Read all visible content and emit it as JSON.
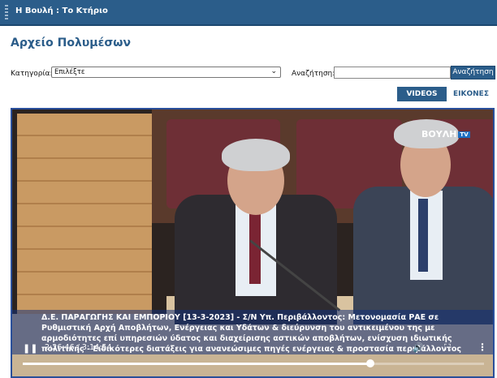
{
  "header": {
    "breadcrumb": "Η Βουλή : Το Κτήριο"
  },
  "page": {
    "title": "Αρχείο Πολυμέσων"
  },
  "filters": {
    "category_label": "Κατηγορία:",
    "category_value": "Επιλέξτε",
    "search_label": "Αναζήτηση:",
    "search_value": "",
    "search_button": "Αναζήτηση"
  },
  "tabs": [
    {
      "label": "VIDEOS",
      "active": true
    },
    {
      "label": "ΕΙΚΟΝΕΣ",
      "active": false
    }
  ],
  "player": {
    "logo_text": "ΒΟΥΛΗ",
    "logo_badge": "TV",
    "caption_lines": [
      "Δ.Ε. ΠΑΡΑΓΩΓΗΣ ΚΑΙ ΕΜΠΟΡΙΟΥ [13-3-2023] - Σ/Ν Υπ. Περιβάλλοντος: Μετονομασία ΡΑΕ σε",
      "Ρυθμιστική Αρχή Αποβλήτων, Ενέργειας και Υδάτων & διεύρυνση του αντικειμένου της με",
      "αρμοδιότητες επί υπηρεσιών ύδατος και διαχείρισης αστικών αποβλήτων, ενίσχυση ιδιωτικής",
      "πολιτικής - Ειδικότερες διατάξεις για ανανεώσιμες πηγές ενέργειας & προστασία περιβάλλοντος"
    ],
    "time_display": "2:26:46 / 3:14:54",
    "progress_fraction": 0.753,
    "icons": {
      "play": "pause-icon",
      "volume": "volume-icon",
      "fullscreen": "fullscreen-icon",
      "more": "more-vertical-icon"
    }
  },
  "colors": {
    "accent": "#2b5d8a",
    "player_border": "#2a4f9a"
  }
}
